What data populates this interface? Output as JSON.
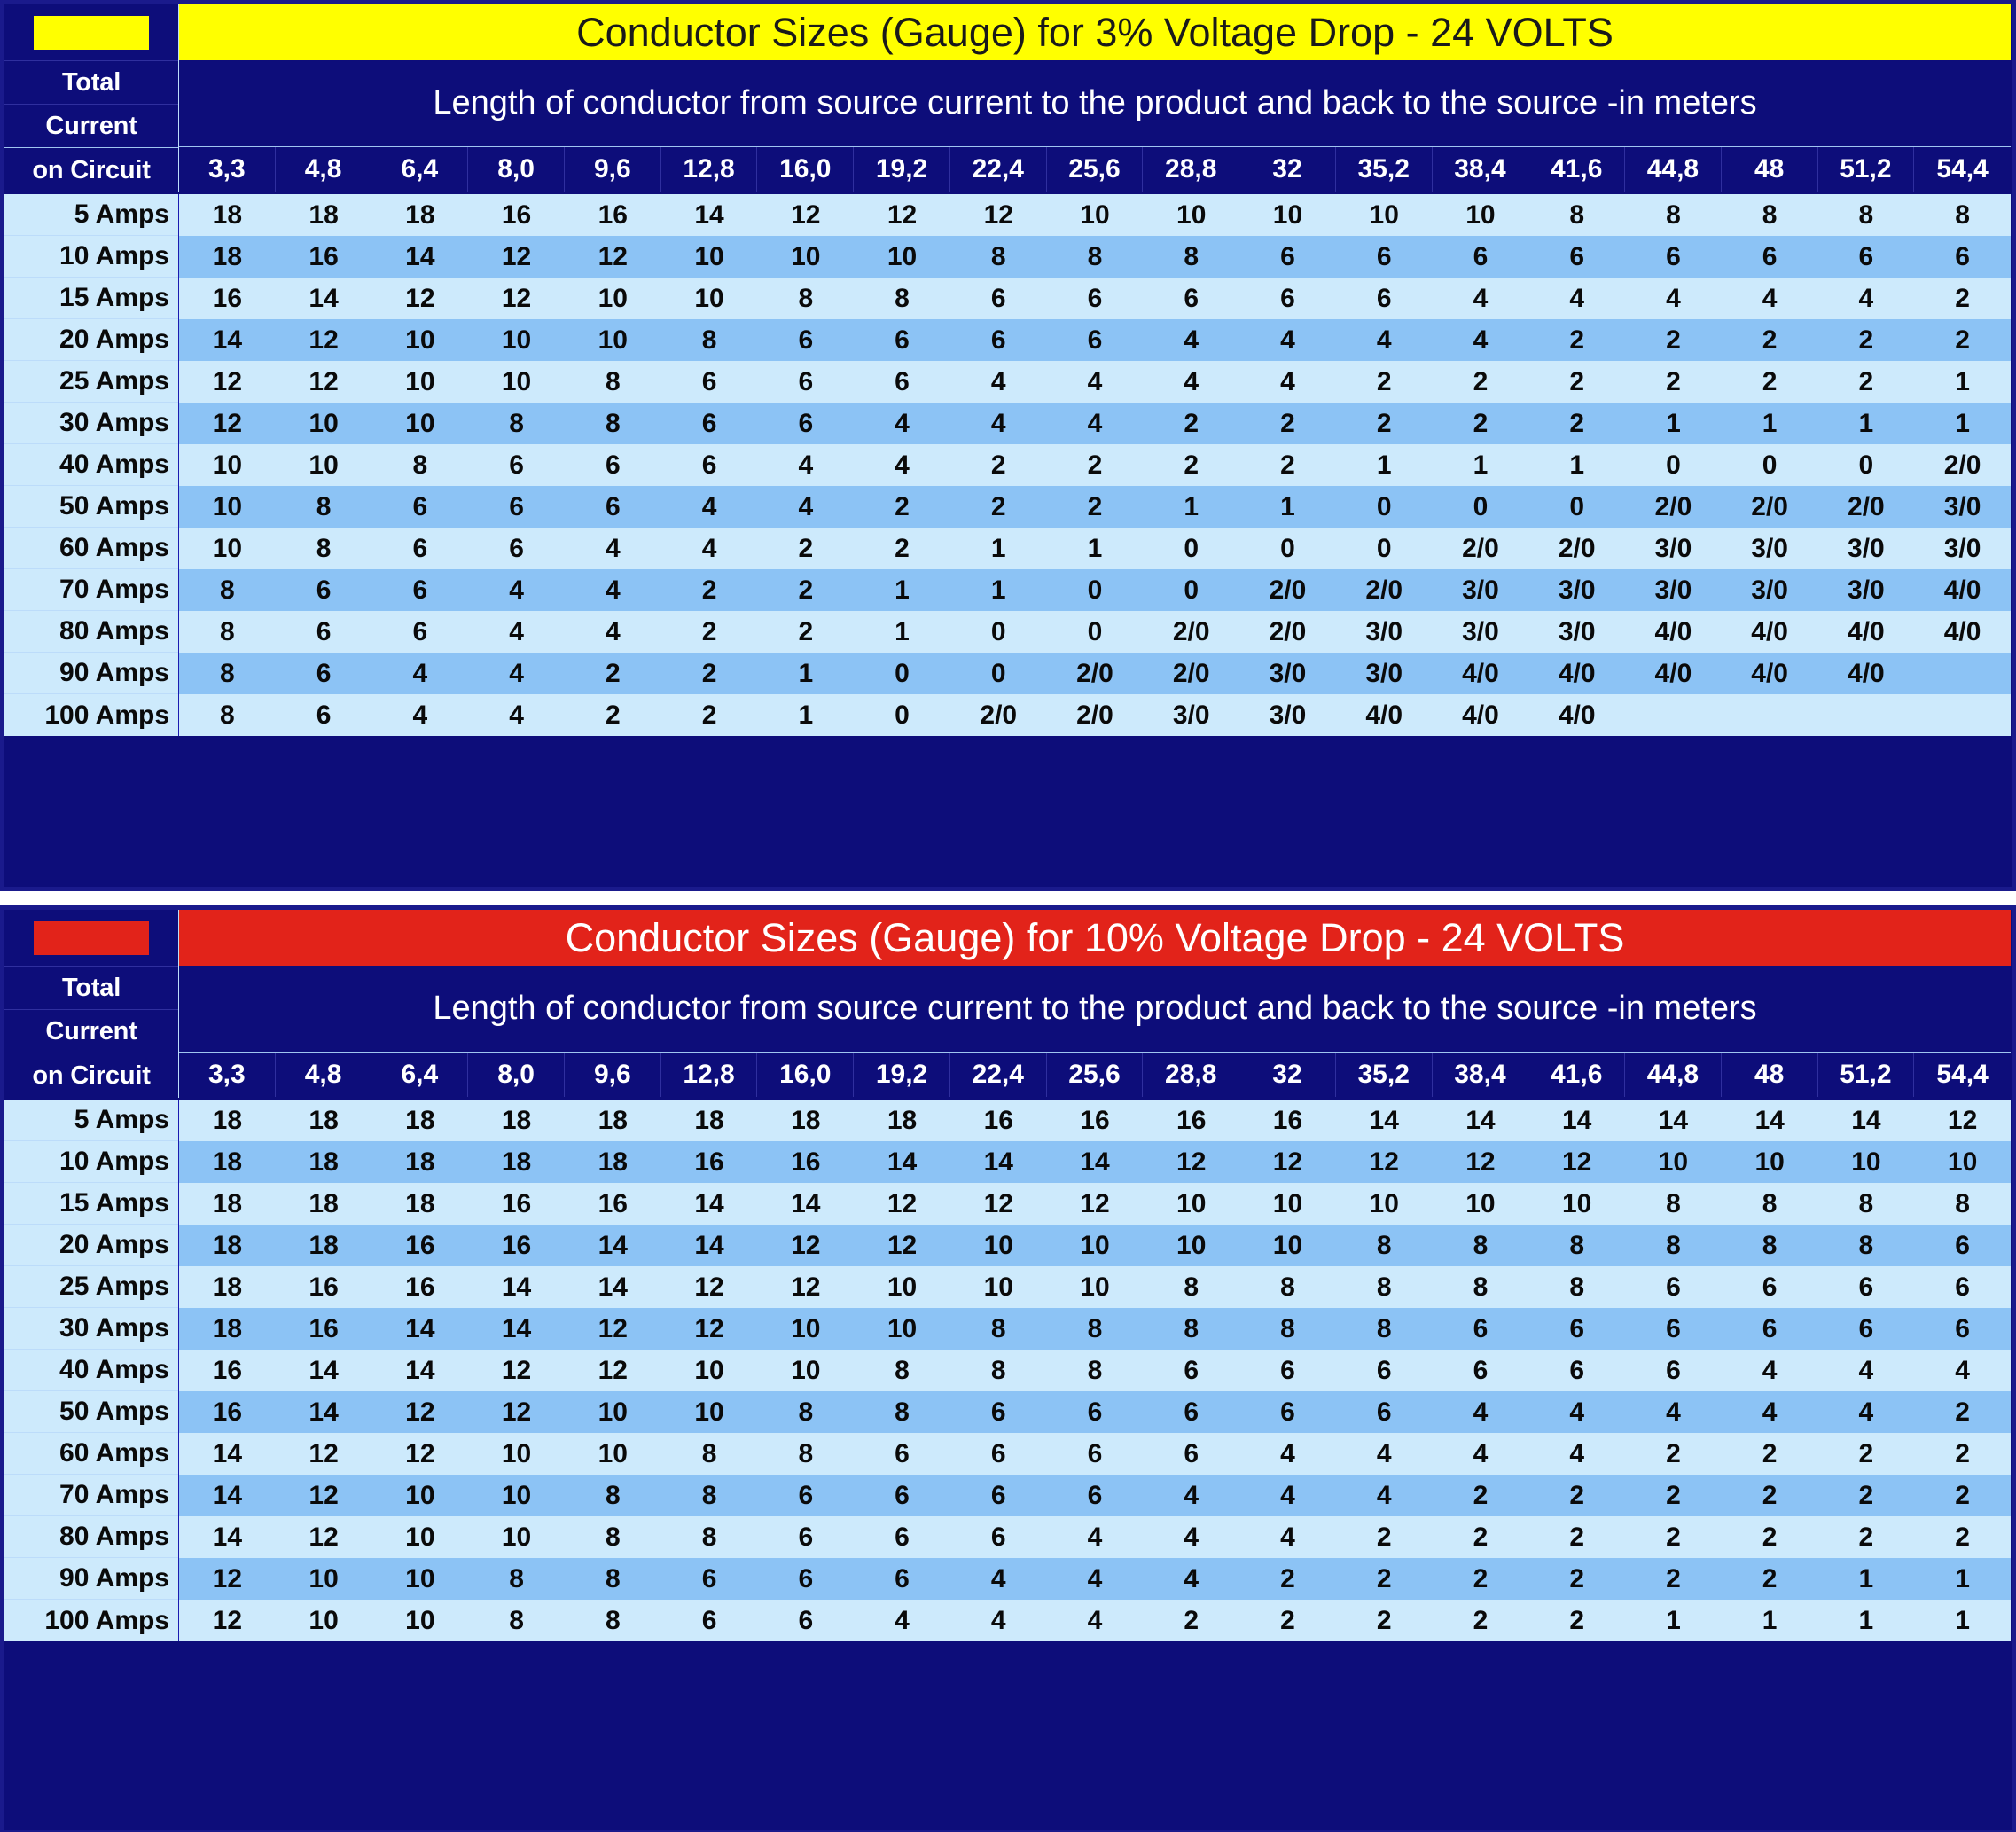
{
  "columns": [
    "3,3",
    "4,8",
    "6,4",
    "8,0",
    "9,6",
    "12,8",
    "16,0",
    "19,2",
    "22,4",
    "25,6",
    "28,8",
    "32",
    "35,2",
    "38,4",
    "41,6",
    "44,8",
    "48",
    "51,2",
    "54,4"
  ],
  "row_labels": [
    "5 Amps",
    "10 Amps",
    "15 Amps",
    "20 Amps",
    "25 Amps",
    "30 Amps",
    "40 Amps",
    "50 Amps",
    "60 Amps",
    "70 Amps",
    "80 Amps",
    "90 Amps",
    "100 Amps"
  ],
  "corner": {
    "line1": "Total",
    "line2": "Current",
    "line3": "on Circuit"
  },
  "subtitle": "Length of conductor from source current to the product and back to the source -in meters",
  "colors": {
    "table1_swatch": "#ffff00",
    "table1_title_bg": "#ffff00",
    "table1_title_text": "#1a1a1a",
    "table2_swatch": "#e2231a",
    "table2_title_bg": "#e2231a",
    "table2_title_text": "#ffffff",
    "header_bg": "#0d0d7a",
    "row_odd": "#cdeafc",
    "row_even": "#8cc3f5",
    "border": "#1a1a8c"
  },
  "table1": {
    "title": "Conductor Sizes (Gauge) for 3% Voltage Drop - 24 VOLTS",
    "swatch_name": "yellow-legend-swatch",
    "rows": [
      [
        "18",
        "18",
        "18",
        "16",
        "16",
        "14",
        "12",
        "12",
        "12",
        "10",
        "10",
        "10",
        "10",
        "10",
        "8",
        "8",
        "8",
        "8",
        "8"
      ],
      [
        "18",
        "16",
        "14",
        "12",
        "12",
        "10",
        "10",
        "10",
        "8",
        "8",
        "8",
        "6",
        "6",
        "6",
        "6",
        "6",
        "6",
        "6",
        "6"
      ],
      [
        "16",
        "14",
        "12",
        "12",
        "10",
        "10",
        "8",
        "8",
        "6",
        "6",
        "6",
        "6",
        "6",
        "4",
        "4",
        "4",
        "4",
        "4",
        "2"
      ],
      [
        "14",
        "12",
        "10",
        "10",
        "10",
        "8",
        "6",
        "6",
        "6",
        "6",
        "4",
        "4",
        "4",
        "4",
        "2",
        "2",
        "2",
        "2",
        "2"
      ],
      [
        "12",
        "12",
        "10",
        "10",
        "8",
        "6",
        "6",
        "6",
        "4",
        "4",
        "4",
        "4",
        "2",
        "2",
        "2",
        "2",
        "2",
        "2",
        "1"
      ],
      [
        "12",
        "10",
        "10",
        "8",
        "8",
        "6",
        "6",
        "4",
        "4",
        "4",
        "2",
        "2",
        "2",
        "2",
        "2",
        "1",
        "1",
        "1",
        "1"
      ],
      [
        "10",
        "10",
        "8",
        "6",
        "6",
        "6",
        "4",
        "4",
        "2",
        "2",
        "2",
        "2",
        "1",
        "1",
        "1",
        "0",
        "0",
        "0",
        "2/0"
      ],
      [
        "10",
        "8",
        "6",
        "6",
        "6",
        "4",
        "4",
        "2",
        "2",
        "2",
        "1",
        "1",
        "0",
        "0",
        "0",
        "2/0",
        "2/0",
        "2/0",
        "3/0"
      ],
      [
        "10",
        "8",
        "6",
        "6",
        "4",
        "4",
        "2",
        "2",
        "1",
        "1",
        "0",
        "0",
        "0",
        "2/0",
        "2/0",
        "3/0",
        "3/0",
        "3/0",
        "3/0"
      ],
      [
        "8",
        "6",
        "6",
        "4",
        "4",
        "2",
        "2",
        "1",
        "1",
        "0",
        "0",
        "2/0",
        "2/0",
        "3/0",
        "3/0",
        "3/0",
        "3/0",
        "3/0",
        "4/0"
      ],
      [
        "8",
        "6",
        "6",
        "4",
        "4",
        "2",
        "2",
        "1",
        "0",
        "0",
        "2/0",
        "2/0",
        "3/0",
        "3/0",
        "3/0",
        "4/0",
        "4/0",
        "4/0",
        "4/0"
      ],
      [
        "8",
        "6",
        "4",
        "4",
        "2",
        "2",
        "1",
        "0",
        "0",
        "2/0",
        "2/0",
        "3/0",
        "3/0",
        "4/0",
        "4/0",
        "4/0",
        "4/0",
        "4/0",
        ""
      ],
      [
        "8",
        "6",
        "4",
        "4",
        "2",
        "2",
        "1",
        "0",
        "2/0",
        "2/0",
        "3/0",
        "3/0",
        "4/0",
        "4/0",
        "4/0",
        "",
        "",
        "",
        ""
      ]
    ]
  },
  "table2": {
    "title": "Conductor Sizes (Gauge) for 10% Voltage Drop - 24 VOLTS",
    "swatch_name": "red-legend-swatch",
    "rows": [
      [
        "18",
        "18",
        "18",
        "18",
        "18",
        "18",
        "18",
        "18",
        "16",
        "16",
        "16",
        "16",
        "14",
        "14",
        "14",
        "14",
        "14",
        "14",
        "12"
      ],
      [
        "18",
        "18",
        "18",
        "18",
        "18",
        "16",
        "16",
        "14",
        "14",
        "14",
        "12",
        "12",
        "12",
        "12",
        "12",
        "10",
        "10",
        "10",
        "10"
      ],
      [
        "18",
        "18",
        "18",
        "16",
        "16",
        "14",
        "14",
        "12",
        "12",
        "12",
        "10",
        "10",
        "10",
        "10",
        "10",
        "8",
        "8",
        "8",
        "8"
      ],
      [
        "18",
        "18",
        "16",
        "16",
        "14",
        "14",
        "12",
        "12",
        "10",
        "10",
        "10",
        "10",
        "8",
        "8",
        "8",
        "8",
        "8",
        "8",
        "6"
      ],
      [
        "18",
        "16",
        "16",
        "14",
        "14",
        "12",
        "12",
        "10",
        "10",
        "10",
        "8",
        "8",
        "8",
        "8",
        "8",
        "6",
        "6",
        "6",
        "6"
      ],
      [
        "18",
        "16",
        "14",
        "14",
        "12",
        "12",
        "10",
        "10",
        "8",
        "8",
        "8",
        "8",
        "8",
        "6",
        "6",
        "6",
        "6",
        "6",
        "6"
      ],
      [
        "16",
        "14",
        "14",
        "12",
        "12",
        "10",
        "10",
        "8",
        "8",
        "8",
        "6",
        "6",
        "6",
        "6",
        "6",
        "6",
        "4",
        "4",
        "4"
      ],
      [
        "16",
        "14",
        "12",
        "12",
        "10",
        "10",
        "8",
        "8",
        "6",
        "6",
        "6",
        "6",
        "6",
        "4",
        "4",
        "4",
        "4",
        "4",
        "2"
      ],
      [
        "14",
        "12",
        "12",
        "10",
        "10",
        "8",
        "8",
        "6",
        "6",
        "6",
        "6",
        "4",
        "4",
        "4",
        "4",
        "2",
        "2",
        "2",
        "2"
      ],
      [
        "14",
        "12",
        "10",
        "10",
        "8",
        "8",
        "6",
        "6",
        "6",
        "6",
        "4",
        "4",
        "4",
        "2",
        "2",
        "2",
        "2",
        "2",
        "2"
      ],
      [
        "14",
        "12",
        "10",
        "10",
        "8",
        "8",
        "6",
        "6",
        "6",
        "4",
        "4",
        "4",
        "2",
        "2",
        "2",
        "2",
        "2",
        "2",
        "2"
      ],
      [
        "12",
        "10",
        "10",
        "8",
        "8",
        "6",
        "6",
        "6",
        "4",
        "4",
        "4",
        "2",
        "2",
        "2",
        "2",
        "2",
        "2",
        "1",
        "1"
      ],
      [
        "12",
        "10",
        "10",
        "8",
        "8",
        "6",
        "6",
        "4",
        "4",
        "4",
        "2",
        "2",
        "2",
        "2",
        "2",
        "1",
        "1",
        "1",
        "1"
      ]
    ]
  }
}
